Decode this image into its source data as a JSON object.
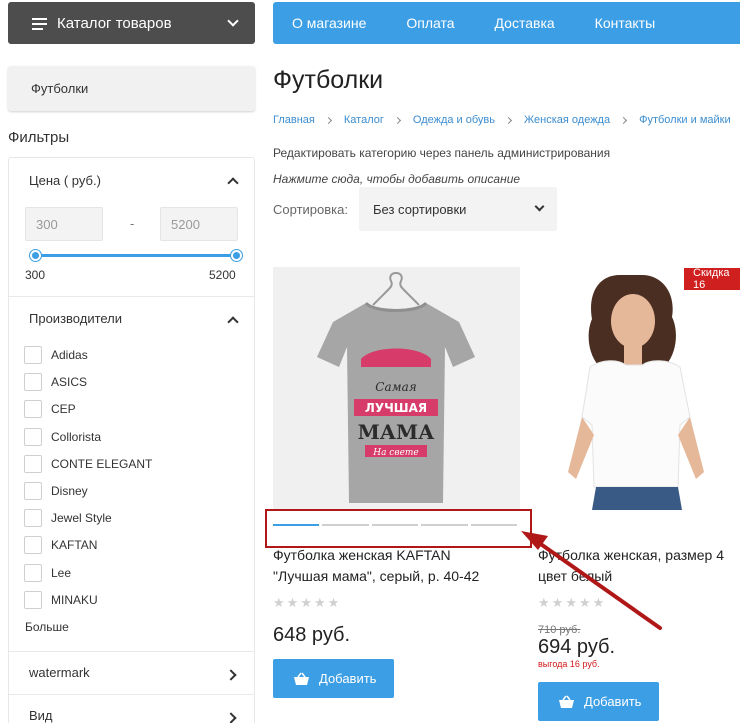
{
  "catalog_button": "Каталог товаров",
  "category_pill": "Футболки",
  "filters": {
    "title": "Фильтры",
    "price": {
      "heading": "Цена ( руб.)",
      "min_value": "300",
      "max_value": "5200",
      "separator": "-",
      "min_label": "300",
      "max_label": "5200"
    },
    "manufacturers": {
      "heading": "Производители",
      "items": [
        "Adidas",
        "ASICS",
        "CEP",
        "Collorista",
        "CONTE ELEGANT",
        "Disney",
        "Jewel Style",
        "KAFTAN",
        "Lee",
        "MINAKU"
      ],
      "more": "Больше"
    },
    "watermark": "watermark",
    "vid": "Вид"
  },
  "nav": [
    "О магазине",
    "Оплата",
    "Доставка",
    "Контакты"
  ],
  "page_title": "Футболки",
  "breadcrumb": [
    "Главная",
    "Каталог",
    "Одежда и обувь",
    "Женская одежда",
    "Футболки и майки"
  ],
  "edit_category": "Редактировать категорию через панель администрирования",
  "add_description": "Нажмите сюда, чтобы добавить описание",
  "sort": {
    "label": "Сортировка:",
    "value": "Без сортировки"
  },
  "products": [
    {
      "name_line1": "Футболка женская KAFTAN",
      "name_line2": "\"Лучшая мама\", серый, р. 40-42",
      "price": "648 руб.",
      "add_label": "Добавить",
      "print_text": [
        "Самая",
        "ЛУЧШАЯ",
        "МАМА",
        "На свете"
      ]
    },
    {
      "name_line1": "Футболка женская, размер 4",
      "name_line2": "цвет белый",
      "old_price": "710 руб.",
      "price": "694 руб.",
      "saving": "выгода 16 руб.",
      "add_label": "Добавить",
      "badge": "Скидка 16"
    }
  ],
  "colors": {
    "accent": "#3c9ee5",
    "dark": "#4d4d4d",
    "highlight": "#b01818",
    "badge": "#d01f1f"
  }
}
